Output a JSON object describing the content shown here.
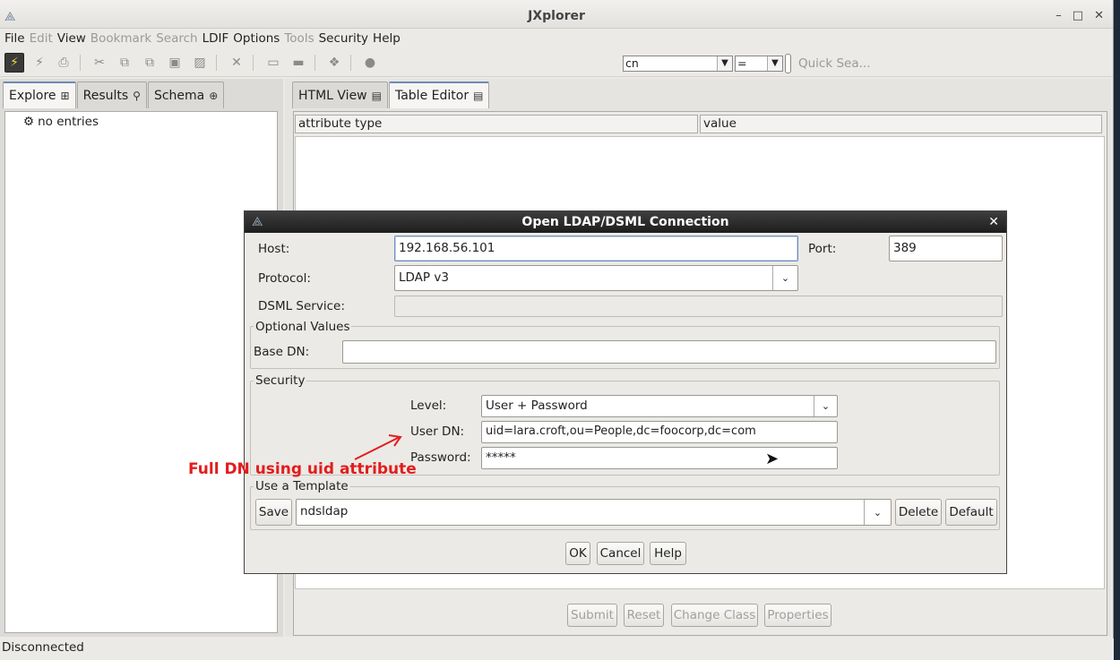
{
  "window": {
    "title": "JXplorer"
  },
  "menu": [
    "File",
    "Edit",
    "View",
    "Bookmark",
    "Search",
    "LDIF",
    "Options",
    "Tools",
    "Security",
    "Help"
  ],
  "menu_disabled": [
    "Edit",
    "Bookmark",
    "Search",
    "Tools"
  ],
  "search": {
    "attribute": "cn",
    "operator": "=",
    "placeholder": "Quick Sea..."
  },
  "left_tabs": [
    "Explore",
    "Results",
    "Schema"
  ],
  "tree": {
    "empty_text": "no entries"
  },
  "right_tabs": [
    "HTML View",
    "Table Editor"
  ],
  "table": {
    "headers": [
      "attribute type",
      "value"
    ]
  },
  "bottom_buttons": [
    "Submit",
    "Reset",
    "Change Class",
    "Properties"
  ],
  "status": "Disconnected",
  "dialog": {
    "title": "Open LDAP/DSML Connection",
    "host_label": "Host:",
    "host_value": "192.168.56.101",
    "port_label": "Port:",
    "port_value": "389",
    "protocol_label": "Protocol:",
    "protocol_value": "LDAP v3",
    "dsml_label": "DSML Service:",
    "optional_title": "Optional Values",
    "basedn_label": "Base DN:",
    "basedn_value": "",
    "security_title": "Security",
    "level_label": "Level:",
    "level_value": "User + Password",
    "userdn_label": "User DN:",
    "userdn_value": "uid=lara.croft,ou=People,dc=foocorp,dc=com",
    "password_label": "Password:",
    "password_value": "*****",
    "template_title": "Use a Template",
    "template_save": "Save",
    "template_value": "ndsldap",
    "template_delete": "Delete",
    "template_default": "Default",
    "ok": "OK",
    "cancel": "Cancel",
    "help": "Help"
  },
  "annotation": {
    "text": "Full DN using uid attribute",
    "color": "#e21d1d"
  }
}
